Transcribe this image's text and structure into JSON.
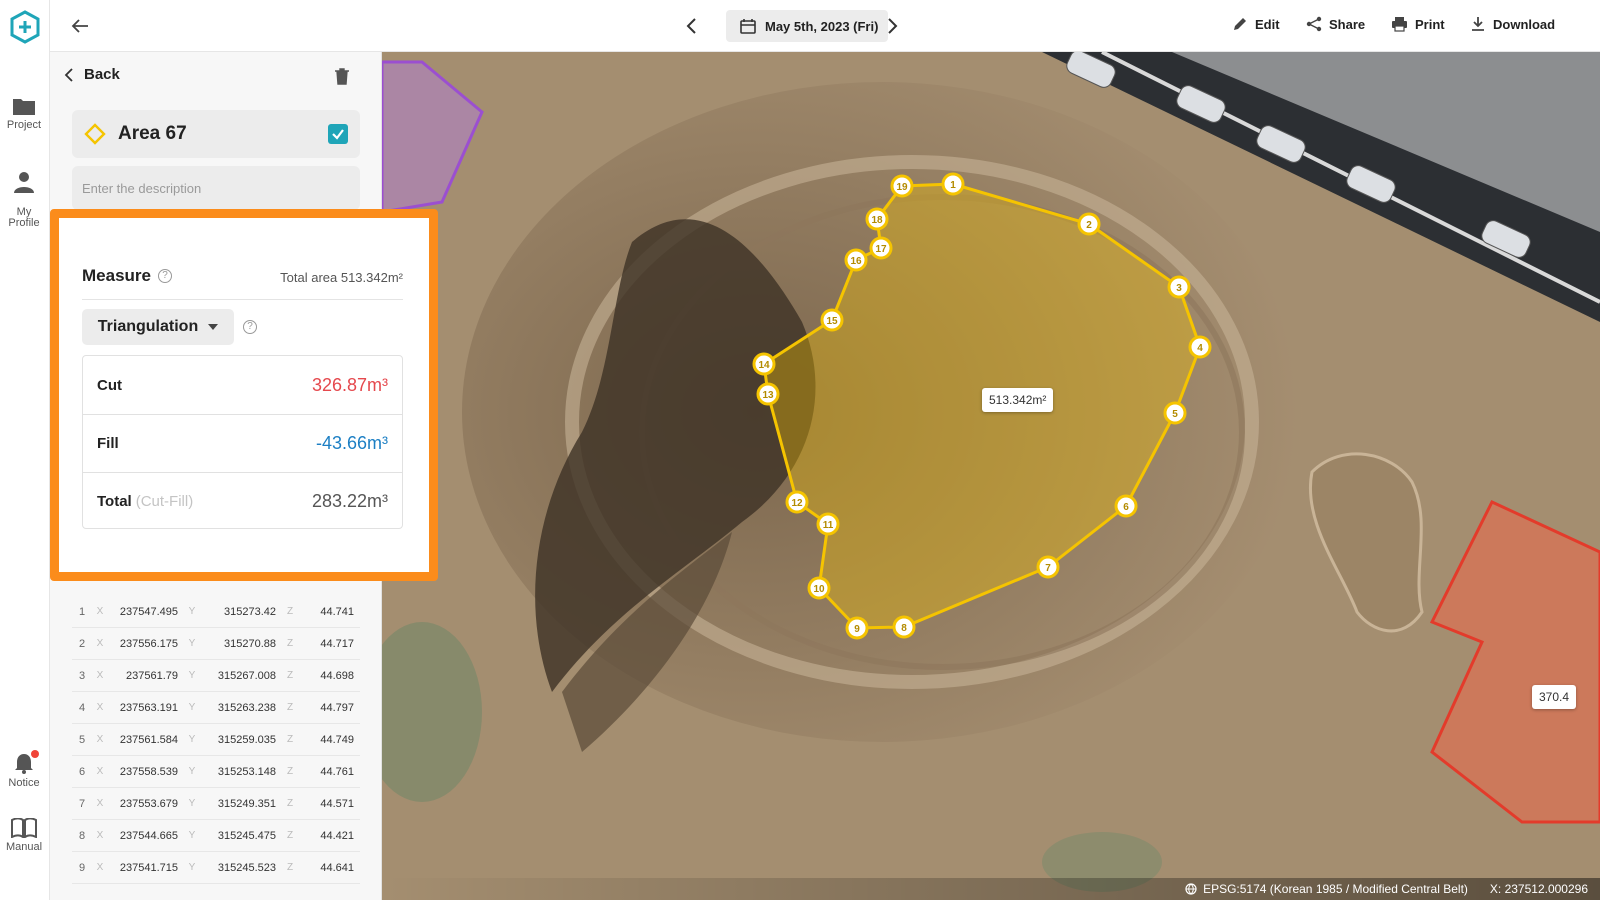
{
  "rail": {
    "items": [
      {
        "label": "Project"
      },
      {
        "label": "My\nProfile"
      },
      {
        "label": "Notice"
      },
      {
        "label": "Manual"
      }
    ]
  },
  "topbar": {
    "date": "May 5th, 2023 (Fri)",
    "actions": {
      "edit": "Edit",
      "share": "Share",
      "print": "Print",
      "download": "Download"
    }
  },
  "panel": {
    "back_label": "Back",
    "area_name": "Area 67",
    "area_checked": true,
    "description_placeholder": "Enter the description",
    "coordinates": [
      {
        "i": "1",
        "x": "237547.495",
        "y": "315273.42",
        "z": "44.741"
      },
      {
        "i": "2",
        "x": "237556.175",
        "y": "315270.88",
        "z": "44.717"
      },
      {
        "i": "3",
        "x": "237561.79",
        "y": "315267.008",
        "z": "44.698"
      },
      {
        "i": "4",
        "x": "237563.191",
        "y": "315263.238",
        "z": "44.797"
      },
      {
        "i": "5",
        "x": "237561.584",
        "y": "315259.035",
        "z": "44.749"
      },
      {
        "i": "6",
        "x": "237558.539",
        "y": "315253.148",
        "z": "44.761"
      },
      {
        "i": "7",
        "x": "237553.679",
        "y": "315249.351",
        "z": "44.571"
      },
      {
        "i": "8",
        "x": "237544.665",
        "y": "315245.475",
        "z": "44.421"
      },
      {
        "i": "9",
        "x": "237541.715",
        "y": "315245.523",
        "z": "44.641"
      }
    ],
    "axis_labels": {
      "x": "X",
      "y": "Y",
      "z": "Z"
    }
  },
  "measure": {
    "title": "Measure",
    "total_area": "Total area 513.342m²",
    "method": "Triangulation",
    "cut_label": "Cut",
    "cut_value": "326.87m³",
    "fill_label": "Fill",
    "fill_value": "-43.66m³",
    "total_label": "Total",
    "total_sub": "(Cut-Fill)",
    "total_value": "283.22m³"
  },
  "map": {
    "area_label": "513.342m²",
    "other_area_label": "370.4",
    "vertex_labels": [
      "1",
      "2",
      "3",
      "4",
      "5",
      "6",
      "7",
      "8",
      "9",
      "10",
      "11",
      "12",
      "13",
      "14",
      "15",
      "16",
      "17",
      "18",
      "19"
    ],
    "crs": "EPSG:5174 (Korean 1985 / Modified Central Belt)",
    "coord_readout": "X: 237512.000296"
  },
  "colors": {
    "accent": "#fb8c1b",
    "cut": "#e5484d",
    "fill": "#1c7fc4",
    "polygon": "#f5c400",
    "checkbox": "#1fa5b8"
  }
}
